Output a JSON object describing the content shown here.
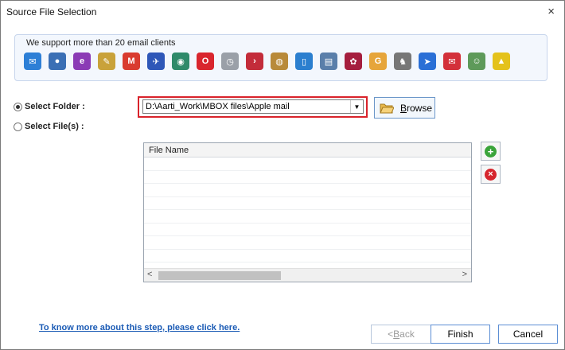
{
  "window": {
    "title": "Source File Selection",
    "close_glyph": "×"
  },
  "clients": {
    "label": "We support more than 20 email clients",
    "icons": [
      {
        "name": "mail-icon",
        "glyph": "✉",
        "color": "#2d7fd6"
      },
      {
        "name": "thunderbird-icon",
        "glyph": "●",
        "color": "#3a6fb5"
      },
      {
        "name": "eudora-icon",
        "glyph": "e",
        "color": "#8b3bb5"
      },
      {
        "name": "pegasus-icon",
        "glyph": "✎",
        "color": "#c9a23a"
      },
      {
        "name": "gmail-icon",
        "glyph": "M",
        "color": "#d93b2f"
      },
      {
        "name": "postbox-icon",
        "glyph": "✈",
        "color": "#2e57b8"
      },
      {
        "name": "seamonkey-icon",
        "glyph": "◉",
        "color": "#2f8a6a"
      },
      {
        "name": "opera-icon",
        "glyph": "O",
        "color": "#d9262e"
      },
      {
        "name": "clock-mail-icon",
        "glyph": "◷",
        "color": "#9aa0a8"
      },
      {
        "name": "arrow-circle-icon",
        "glyph": "›",
        "color": "#c32c3a"
      },
      {
        "name": "globe-icon",
        "glyph": "◍",
        "color": "#b88a3a"
      },
      {
        "name": "phone-icon",
        "glyph": "▯",
        "color": "#2b7fcf"
      },
      {
        "name": "mail-stack-icon",
        "glyph": "▤",
        "color": "#5a7faa"
      },
      {
        "name": "grapes-icon",
        "glyph": "✿",
        "color": "#a51e3e"
      },
      {
        "name": "g-icon",
        "glyph": "G",
        "color": "#e6a53a"
      },
      {
        "name": "gnu-icon",
        "glyph": "♞",
        "color": "#777777"
      },
      {
        "name": "send-icon",
        "glyph": "➤",
        "color": "#2a6fd6"
      },
      {
        "name": "envelope-red-icon",
        "glyph": "✉",
        "color": "#d3303a"
      },
      {
        "name": "mascot-icon",
        "glyph": "☺",
        "color": "#5e9a5a"
      },
      {
        "name": "bat-icon",
        "glyph": "▲",
        "color": "#e4c21b"
      }
    ]
  },
  "options": {
    "folder_label": "Select Folder :",
    "files_label": "Select File(s) :",
    "folder_checked": true,
    "path_value": "D:\\Aarti_Work\\MBOX files\\Apple mail",
    "browse_label_u": "B",
    "browse_label_rest": "rowse"
  },
  "grid": {
    "column": "File Name",
    "rows": 9
  },
  "help_link": "To know more about this step, please click here.",
  "buttons": {
    "back_prefix": "< ",
    "back_u": "B",
    "back_rest": "ack",
    "finish": "Finish",
    "cancel": "Cancel"
  }
}
